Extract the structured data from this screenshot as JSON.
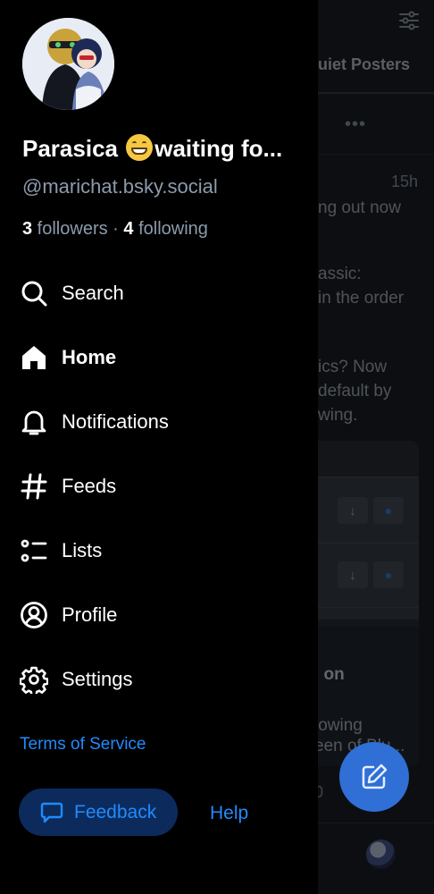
{
  "background_feed": {
    "tab_label": "uiet Posters",
    "more_label": "•••",
    "post_time": "15h",
    "post_lines": [
      "ng out now",
      "assic:",
      "in the order",
      "ics? Now",
      "default by",
      "wing."
    ],
    "card_title": "l on",
    "card_lines": [
      "lowing",
      "een of Blu..."
    ],
    "footer_count": "0",
    "fab_icon": "compose-icon",
    "filter_icon": "sliders-icon"
  },
  "drawer": {
    "profile": {
      "display_name_before": "Parasica ",
      "emoji": "grinning-face-emoji",
      "display_name_after": "waiting fo...",
      "handle": "@marichat.bsky.social",
      "followers_count": "3",
      "followers_label": " followers",
      "separator": " · ",
      "following_count": "4",
      "following_label": " following"
    },
    "nav": [
      {
        "label": "Search",
        "icon": "search-icon",
        "active": false
      },
      {
        "label": "Home",
        "icon": "home-icon",
        "active": true
      },
      {
        "label": "Notifications",
        "icon": "bell-icon",
        "active": false
      },
      {
        "label": "Feeds",
        "icon": "hashtag-icon",
        "active": false
      },
      {
        "label": "Lists",
        "icon": "list-icon",
        "active": false
      },
      {
        "label": "Profile",
        "icon": "user-circle-icon",
        "active": false
      },
      {
        "label": "Settings",
        "icon": "gear-icon",
        "active": false
      }
    ],
    "terms_label": "Terms of Service",
    "feedback_label": "Feedback",
    "feedback_icon": "message-icon",
    "help_label": "Help"
  },
  "colors": {
    "accent": "#208bfe",
    "drawer_bg": "#000000",
    "muted_text": "#8c9bab",
    "feedback_bg": "#0c2b5c"
  }
}
